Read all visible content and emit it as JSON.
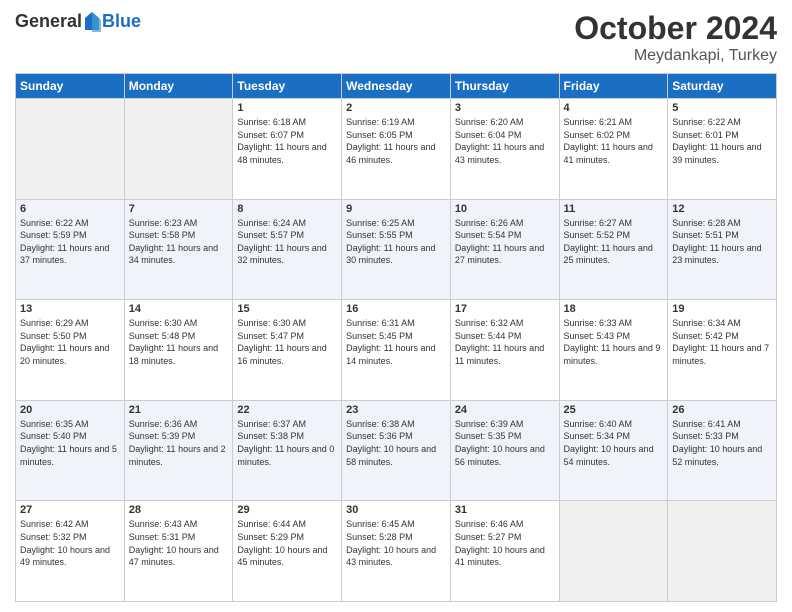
{
  "header": {
    "logo": {
      "general": "General",
      "blue": "Blue"
    },
    "title": "October 2024",
    "location": "Meydankapi, Turkey"
  },
  "days_of_week": [
    "Sunday",
    "Monday",
    "Tuesday",
    "Wednesday",
    "Thursday",
    "Friday",
    "Saturday"
  ],
  "weeks": [
    [
      {
        "day": "",
        "sunrise": "",
        "sunset": "",
        "daylight": ""
      },
      {
        "day": "",
        "sunrise": "",
        "sunset": "",
        "daylight": ""
      },
      {
        "day": "1",
        "sunrise": "Sunrise: 6:18 AM",
        "sunset": "Sunset: 6:07 PM",
        "daylight": "Daylight: 11 hours and 48 minutes."
      },
      {
        "day": "2",
        "sunrise": "Sunrise: 6:19 AM",
        "sunset": "Sunset: 6:05 PM",
        "daylight": "Daylight: 11 hours and 46 minutes."
      },
      {
        "day": "3",
        "sunrise": "Sunrise: 6:20 AM",
        "sunset": "Sunset: 6:04 PM",
        "daylight": "Daylight: 11 hours and 43 minutes."
      },
      {
        "day": "4",
        "sunrise": "Sunrise: 6:21 AM",
        "sunset": "Sunset: 6:02 PM",
        "daylight": "Daylight: 11 hours and 41 minutes."
      },
      {
        "day": "5",
        "sunrise": "Sunrise: 6:22 AM",
        "sunset": "Sunset: 6:01 PM",
        "daylight": "Daylight: 11 hours and 39 minutes."
      }
    ],
    [
      {
        "day": "6",
        "sunrise": "Sunrise: 6:22 AM",
        "sunset": "Sunset: 5:59 PM",
        "daylight": "Daylight: 11 hours and 37 minutes."
      },
      {
        "day": "7",
        "sunrise": "Sunrise: 6:23 AM",
        "sunset": "Sunset: 5:58 PM",
        "daylight": "Daylight: 11 hours and 34 minutes."
      },
      {
        "day": "8",
        "sunrise": "Sunrise: 6:24 AM",
        "sunset": "Sunset: 5:57 PM",
        "daylight": "Daylight: 11 hours and 32 minutes."
      },
      {
        "day": "9",
        "sunrise": "Sunrise: 6:25 AM",
        "sunset": "Sunset: 5:55 PM",
        "daylight": "Daylight: 11 hours and 30 minutes."
      },
      {
        "day": "10",
        "sunrise": "Sunrise: 6:26 AM",
        "sunset": "Sunset: 5:54 PM",
        "daylight": "Daylight: 11 hours and 27 minutes."
      },
      {
        "day": "11",
        "sunrise": "Sunrise: 6:27 AM",
        "sunset": "Sunset: 5:52 PM",
        "daylight": "Daylight: 11 hours and 25 minutes."
      },
      {
        "day": "12",
        "sunrise": "Sunrise: 6:28 AM",
        "sunset": "Sunset: 5:51 PM",
        "daylight": "Daylight: 11 hours and 23 minutes."
      }
    ],
    [
      {
        "day": "13",
        "sunrise": "Sunrise: 6:29 AM",
        "sunset": "Sunset: 5:50 PM",
        "daylight": "Daylight: 11 hours and 20 minutes."
      },
      {
        "day": "14",
        "sunrise": "Sunrise: 6:30 AM",
        "sunset": "Sunset: 5:48 PM",
        "daylight": "Daylight: 11 hours and 18 minutes."
      },
      {
        "day": "15",
        "sunrise": "Sunrise: 6:30 AM",
        "sunset": "Sunset: 5:47 PM",
        "daylight": "Daylight: 11 hours and 16 minutes."
      },
      {
        "day": "16",
        "sunrise": "Sunrise: 6:31 AM",
        "sunset": "Sunset: 5:45 PM",
        "daylight": "Daylight: 11 hours and 14 minutes."
      },
      {
        "day": "17",
        "sunrise": "Sunrise: 6:32 AM",
        "sunset": "Sunset: 5:44 PM",
        "daylight": "Daylight: 11 hours and 11 minutes."
      },
      {
        "day": "18",
        "sunrise": "Sunrise: 6:33 AM",
        "sunset": "Sunset: 5:43 PM",
        "daylight": "Daylight: 11 hours and 9 minutes."
      },
      {
        "day": "19",
        "sunrise": "Sunrise: 6:34 AM",
        "sunset": "Sunset: 5:42 PM",
        "daylight": "Daylight: 11 hours and 7 minutes."
      }
    ],
    [
      {
        "day": "20",
        "sunrise": "Sunrise: 6:35 AM",
        "sunset": "Sunset: 5:40 PM",
        "daylight": "Daylight: 11 hours and 5 minutes."
      },
      {
        "day": "21",
        "sunrise": "Sunrise: 6:36 AM",
        "sunset": "Sunset: 5:39 PM",
        "daylight": "Daylight: 11 hours and 2 minutes."
      },
      {
        "day": "22",
        "sunrise": "Sunrise: 6:37 AM",
        "sunset": "Sunset: 5:38 PM",
        "daylight": "Daylight: 11 hours and 0 minutes."
      },
      {
        "day": "23",
        "sunrise": "Sunrise: 6:38 AM",
        "sunset": "Sunset: 5:36 PM",
        "daylight": "Daylight: 10 hours and 58 minutes."
      },
      {
        "day": "24",
        "sunrise": "Sunrise: 6:39 AM",
        "sunset": "Sunset: 5:35 PM",
        "daylight": "Daylight: 10 hours and 56 minutes."
      },
      {
        "day": "25",
        "sunrise": "Sunrise: 6:40 AM",
        "sunset": "Sunset: 5:34 PM",
        "daylight": "Daylight: 10 hours and 54 minutes."
      },
      {
        "day": "26",
        "sunrise": "Sunrise: 6:41 AM",
        "sunset": "Sunset: 5:33 PM",
        "daylight": "Daylight: 10 hours and 52 minutes."
      }
    ],
    [
      {
        "day": "27",
        "sunrise": "Sunrise: 6:42 AM",
        "sunset": "Sunset: 5:32 PM",
        "daylight": "Daylight: 10 hours and 49 minutes."
      },
      {
        "day": "28",
        "sunrise": "Sunrise: 6:43 AM",
        "sunset": "Sunset: 5:31 PM",
        "daylight": "Daylight: 10 hours and 47 minutes."
      },
      {
        "day": "29",
        "sunrise": "Sunrise: 6:44 AM",
        "sunset": "Sunset: 5:29 PM",
        "daylight": "Daylight: 10 hours and 45 minutes."
      },
      {
        "day": "30",
        "sunrise": "Sunrise: 6:45 AM",
        "sunset": "Sunset: 5:28 PM",
        "daylight": "Daylight: 10 hours and 43 minutes."
      },
      {
        "day": "31",
        "sunrise": "Sunrise: 6:46 AM",
        "sunset": "Sunset: 5:27 PM",
        "daylight": "Daylight: 10 hours and 41 minutes."
      },
      {
        "day": "",
        "sunrise": "",
        "sunset": "",
        "daylight": ""
      },
      {
        "day": "",
        "sunrise": "",
        "sunset": "",
        "daylight": ""
      }
    ]
  ]
}
